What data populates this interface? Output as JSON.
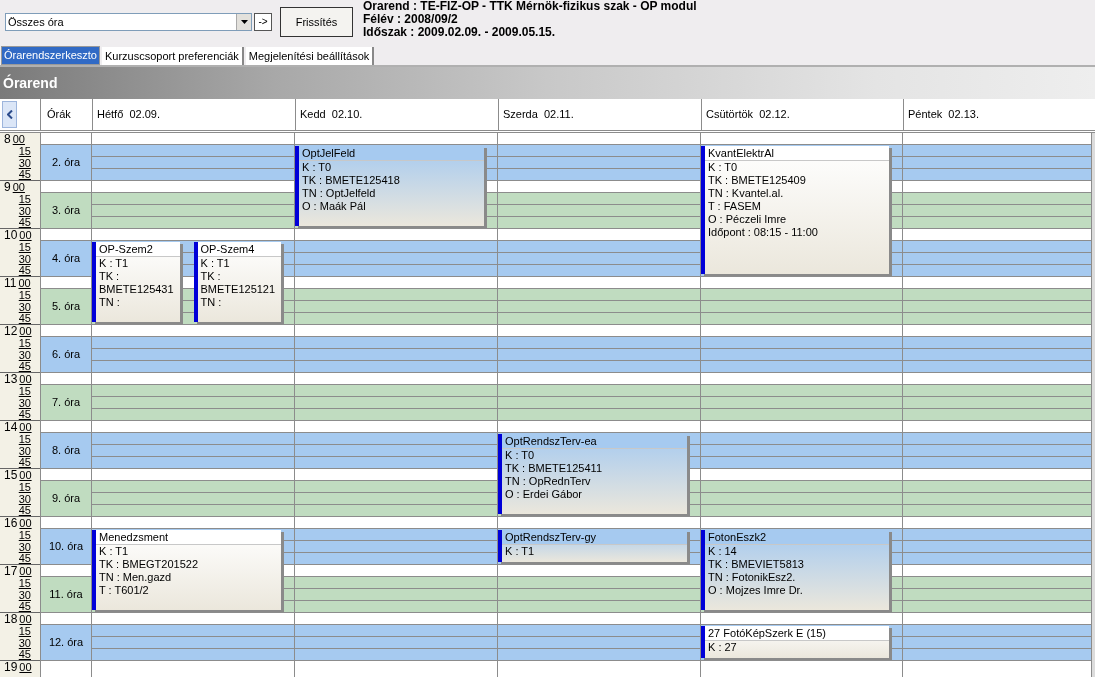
{
  "toolbar": {
    "filter": {
      "value": "Összes óra"
    },
    "go_button": "->",
    "refresh_button": "Frissítés",
    "info": [
      "Órarend : TE-FIZ-OP - TTK Mérnök-fizikus szak - OP modul",
      "Félév : 2008/09/2",
      "Időszak : 2009.02.09. - 2009.05.15."
    ]
  },
  "tabs": [
    {
      "label": "Órarendszerkeszto",
      "selected": true
    },
    {
      "label": "Kurzuscsoport preferenciák",
      "selected": false
    },
    {
      "label": "Megjelenítési beállítások",
      "selected": false
    }
  ],
  "section_title": "Órarend",
  "grid": {
    "periods_header": "Órák",
    "hours": [
      {
        "hour": "8",
        "minutes": [
          "00",
          "15",
          "30",
          "45"
        ]
      },
      {
        "hour": "9",
        "minutes": [
          "00",
          "15",
          "30",
          "45"
        ]
      },
      {
        "hour": "10",
        "minutes": [
          "00",
          "15",
          "30",
          "45"
        ]
      },
      {
        "hour": "11",
        "minutes": [
          "00",
          "15",
          "30",
          "45"
        ]
      },
      {
        "hour": "12",
        "minutes": [
          "00",
          "15",
          "30",
          "45"
        ]
      },
      {
        "hour": "13",
        "minutes": [
          "00",
          "15",
          "30",
          "45"
        ]
      },
      {
        "hour": "14",
        "minutes": [
          "00",
          "15",
          "30",
          "45"
        ]
      },
      {
        "hour": "15",
        "minutes": [
          "00",
          "15",
          "30",
          "45"
        ]
      },
      {
        "hour": "16",
        "minutes": [
          "00",
          "15",
          "30",
          "45"
        ]
      },
      {
        "hour": "17",
        "minutes": [
          "00",
          "15",
          "30",
          "45"
        ]
      },
      {
        "hour": "18",
        "minutes": [
          "00",
          "15",
          "30",
          "45"
        ]
      },
      {
        "hour": "19",
        "minutes": [
          "00"
        ]
      }
    ],
    "periods": [
      {
        "label": "2. óra",
        "color": "#a6caf0"
      },
      {
        "label": "3. óra",
        "color": "#c0dcc0"
      },
      {
        "label": "4. óra",
        "color": "#a6caf0"
      },
      {
        "label": "5. óra",
        "color": "#c0dcc0"
      },
      {
        "label": "6. óra",
        "color": "#a6caf0"
      },
      {
        "label": "7. óra",
        "color": "#c0dcc0"
      },
      {
        "label": "8. óra",
        "color": "#a6caf0"
      },
      {
        "label": "9. óra",
        "color": "#c0dcc0"
      },
      {
        "label": "10. óra",
        "color": "#a6caf0"
      },
      {
        "label": "11. óra",
        "color": "#c0dcc0"
      },
      {
        "label": "12. óra",
        "color": "#a6caf0"
      }
    ],
    "days": [
      {
        "label": "Hétfő  02.09.",
        "slots": [
          {
            "color": "#a6caf0"
          },
          {
            "color": "#c0dcc0"
          },
          {
            "color": "#a6caf0",
            "events": [
              {
                "kind": "start",
                "title": "OP-Szem2",
                "color": "#ffffff",
                "lines": [
                  "K : T1",
                  "TK : BMETE125431",
                  "TN :"
                ]
              },
              {
                "kind": "start",
                "title": "OP-Szem4",
                "color": "#ffffff",
                "lines": [
                  "K : T1",
                  "TK : BMETE125121",
                  "TN :"
                ]
              }
            ]
          },
          {
            "color": "#c0dcc0",
            "events": [
              {
                "kind": "continued"
              },
              {
                "kind": "continued"
              }
            ]
          },
          {
            "color": "#a6caf0"
          },
          {
            "color": "#c0dcc0"
          },
          {
            "color": "#a6caf0"
          },
          {
            "color": "#c0dcc0"
          },
          {
            "color": "#a6caf0",
            "events": [
              {
                "kind": "start",
                "title": "Menedzsment",
                "color": "#ffffff",
                "lines": [
                  "K : T1",
                  "TK : BMEGT201522",
                  "TN : Men.gazd",
                  "T : T601/2"
                ]
              }
            ]
          },
          {
            "color": "#c0dcc0",
            "events": [
              {
                "kind": "continued"
              }
            ]
          },
          {
            "color": "#a6caf0"
          }
        ]
      },
      {
        "label": "Kedd  02.10.",
        "slots": [
          {
            "color": "#a6caf0",
            "events": [
              {
                "kind": "start",
                "title": "OptJelFeld",
                "color": "#a6caf0",
                "lines": [
                  "K : T0",
                  "TK : BMETE125418",
                  "TN : OptJelfeld",
                  "O : Maák Pál"
                ]
              }
            ]
          },
          {
            "color": "#c0dcc0",
            "events": [
              {
                "kind": "continued"
              }
            ]
          },
          {
            "color": "#a6caf0"
          },
          {
            "color": "#c0dcc0"
          },
          {
            "color": "#a6caf0"
          },
          {
            "color": "#c0dcc0"
          },
          {
            "color": "#a6caf0"
          },
          {
            "color": "#c0dcc0"
          },
          {
            "color": "#a6caf0"
          },
          {
            "color": "#c0dcc0"
          },
          {
            "color": "#a6caf0"
          }
        ]
      },
      {
        "label": "Szerda  02.11.",
        "slots": [
          {
            "color": "#a6caf0"
          },
          {
            "color": "#c0dcc0"
          },
          {
            "color": "#a6caf0"
          },
          {
            "color": "#c0dcc0"
          },
          {
            "color": "#a6caf0"
          },
          {
            "color": "#c0dcc0"
          },
          {
            "color": "#a6caf0",
            "events": [
              {
                "kind": "start",
                "title": "OptRendszTerv-ea",
                "color": "#a6caf0",
                "lines": [
                  "K : T0",
                  "TK : BMETE125411",
                  "TN : OpRednTerv",
                  "O : Erdei Gábor"
                ]
              }
            ]
          },
          {
            "color": "#c0dcc0",
            "events": [
              {
                "kind": "continued"
              }
            ]
          },
          {
            "color": "#a6caf0",
            "events": [
              {
                "kind": "start",
                "title": "OptRendszTerv-gy",
                "color": "#a6caf0",
                "lines": [
                  "K : T1"
                ]
              }
            ]
          },
          {
            "color": "#c0dcc0"
          },
          {
            "color": "#a6caf0"
          }
        ]
      },
      {
        "label": "Csütörtök  02.12.",
        "slots": [
          {
            "color": "#a6caf0",
            "events": [
              {
                "kind": "start",
                "title": "KvantElektrAl",
                "color": "#ffffff",
                "lines": [
                  "K : T0",
                  "TK : BMETE125409",
                  "TN : Kvantel.al.",
                  "T : FASEM",
                  "O : Péczeli Imre",
                  "Időpont : 08:15 - 11:00"
                ]
              }
            ]
          },
          {
            "color": "#c0dcc0",
            "events": [
              {
                "kind": "continued"
              }
            ]
          },
          {
            "color": "#a6caf0",
            "events": [
              {
                "kind": "continued"
              }
            ]
          },
          {
            "color": "#c0dcc0"
          },
          {
            "color": "#a6caf0"
          },
          {
            "color": "#c0dcc0"
          },
          {
            "color": "#a6caf0"
          },
          {
            "color": "#c0dcc0"
          },
          {
            "color": "#a6caf0",
            "events": [
              {
                "kind": "start",
                "title": "FotonEszk2",
                "color": "#a6caf0",
                "lines": [
                  "K : 14",
                  "TK : BMEVIET5813",
                  "TN : FotonikEsz2.",
                  "O : Mojzes Imre Dr."
                ]
              }
            ]
          },
          {
            "color": "#c0dcc0",
            "events": [
              {
                "kind": "continued"
              }
            ]
          },
          {
            "color": "#a6caf0",
            "events": [
              {
                "kind": "start",
                "title": "27 FotóKépSzerk E (15)",
                "color": "#ffffff",
                "lines": [
                  "K : 27"
                ]
              }
            ]
          }
        ]
      },
      {
        "label": "Péntek  02.13.",
        "slots": [
          {
            "color": "#a6caf0"
          },
          {
            "color": "#c0dcc0"
          },
          {
            "color": "#a6caf0"
          },
          {
            "color": "#c0dcc0"
          },
          {
            "color": "#a6caf0"
          },
          {
            "color": "#c0dcc0"
          },
          {
            "color": "#a6caf0"
          },
          {
            "color": "#c0dcc0"
          },
          {
            "color": "#a6caf0"
          },
          {
            "color": "#c0dcc0"
          },
          {
            "color": "#a6caf0"
          }
        ]
      }
    ]
  }
}
